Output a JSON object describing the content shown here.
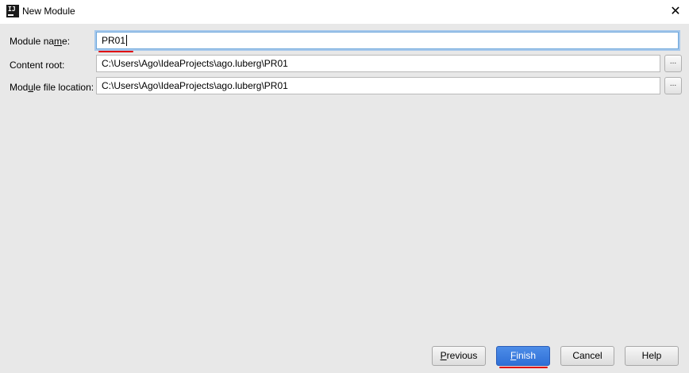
{
  "window": {
    "title": "New Module",
    "app_icon_text": "IJ",
    "close_glyph": "✕"
  },
  "form": {
    "module_name": {
      "label_pre": "Module na",
      "label_mnemonic": "m",
      "label_post": "e:",
      "value": "PR01"
    },
    "content_root": {
      "label": "Content root:",
      "value": "C:\\Users\\Ago\\IdeaProjects\\ago.luberg\\PR01",
      "browse_label": "..."
    },
    "module_file_location": {
      "label_pre": "Mod",
      "label_mnemonic": "u",
      "label_post": "le file location:",
      "value": "C:\\Users\\Ago\\IdeaProjects\\ago.luberg\\PR01",
      "browse_label": "..."
    }
  },
  "buttons": {
    "previous": {
      "mnemonic": "P",
      "rest": "revious"
    },
    "finish": {
      "mnemonic": "F",
      "rest": "inish"
    },
    "cancel": "Cancel",
    "help": "Help"
  },
  "colors": {
    "accent": "#2f6fd6",
    "annotation_red": "#e00000",
    "background": "#e8e8e8"
  }
}
